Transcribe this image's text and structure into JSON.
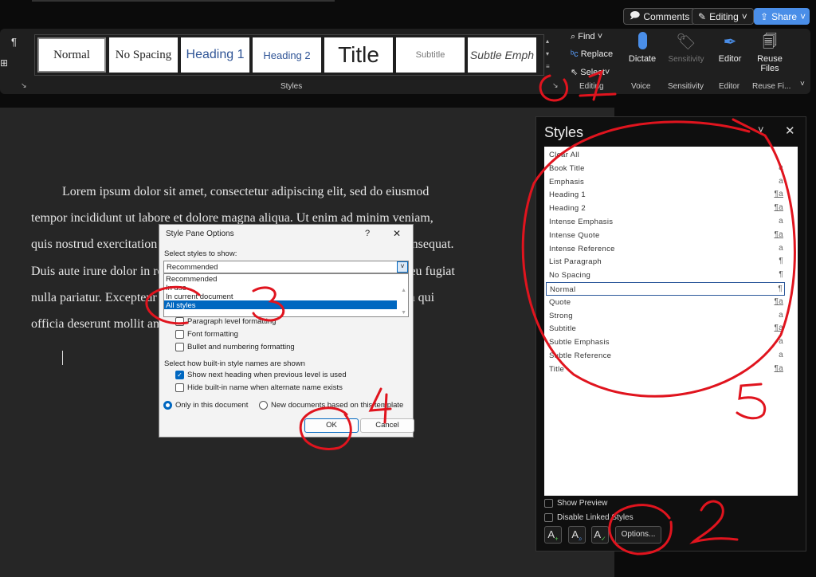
{
  "topbar": {
    "comments": "Comments",
    "editing": "Editing",
    "share": "Share"
  },
  "ribbon": {
    "gallery": [
      "Normal",
      "No Spacing",
      "Heading 1",
      "Heading 2",
      "Title",
      "Subtitle",
      "Subtle Emph"
    ],
    "styles_group": "Styles",
    "editing": {
      "find": "Find",
      "replace": "Replace",
      "select": "Select",
      "group": "Editing"
    },
    "voice": {
      "dictate": "Dictate",
      "group": "Voice"
    },
    "sensitivity": {
      "label": "Sensitivity",
      "group": "Sensitivity"
    },
    "editor": {
      "label": "Editor",
      "group": "Editor"
    },
    "reuse": {
      "label1": "Reuse",
      "label2": "Files",
      "group": "Reuse Fi..."
    },
    "pilcrow": "¶"
  },
  "document": {
    "lines": [
      "Lorem ipsum dolor sit amet, consectetur adipiscing elit, sed do eiusmod",
      "tempor incididunt ut labore et dolore magna aliqua. Ut enim ad minim veniam,",
      "quis nostrud exercitation ullamco laboris nisi ut aliquip ex ea commodo consequat.",
      "Duis aute irure dolor in reprehenderit in voluptate velit esse cillum dolore eu fugiat",
      "nulla pariatur. Excepteur sint occaecat cupidatat non proident, sunt in culpa qui",
      "officia deserunt mollit anim id est laborum."
    ]
  },
  "styles_pane": {
    "title": "Styles",
    "items": [
      {
        "name": "Clear All",
        "mark": ""
      },
      {
        "name": "Book Title",
        "mark": "a"
      },
      {
        "name": "Emphasis",
        "mark": "a"
      },
      {
        "name": "Heading 1",
        "mark": "¶a"
      },
      {
        "name": "Heading 2",
        "mark": "¶a"
      },
      {
        "name": "Intense Emphasis",
        "mark": "a"
      },
      {
        "name": "Intense Quote",
        "mark": "¶a"
      },
      {
        "name": "Intense Reference",
        "mark": "a"
      },
      {
        "name": "List Paragraph",
        "mark": "¶"
      },
      {
        "name": "No Spacing",
        "mark": "¶"
      },
      {
        "name": "Normal",
        "mark": "¶"
      },
      {
        "name": "Quote",
        "mark": "¶a"
      },
      {
        "name": "Strong",
        "mark": "a"
      },
      {
        "name": "Subtitle",
        "mark": "¶a"
      },
      {
        "name": "Subtle Emphasis",
        "mark": "a"
      },
      {
        "name": "Subtle Reference",
        "mark": "a"
      },
      {
        "name": "Title",
        "mark": "¶a"
      }
    ],
    "selected": "Normal",
    "show_preview": "Show Preview",
    "disable_linked": "Disable Linked Styles",
    "options": "Options..."
  },
  "dialog": {
    "title": "Style Pane Options",
    "help": "?",
    "select_label": "Select styles to show:",
    "select_value": "Recommended",
    "options": [
      "Recommended",
      "In use",
      "In current document",
      "All styles"
    ],
    "highlighted": "All styles",
    "chk_paragraph": "Paragraph level formatting",
    "chk_font": "Font formatting",
    "chk_bullet": "Bullet and numbering formatting",
    "names_label": "Select how built-in style names are shown",
    "chk_show_next": "Show next heading when previous level is used",
    "chk_hide_builtin": "Hide built-in name when alternate name exists",
    "radio_only": "Only in this document",
    "radio_new": "New documents based on this template",
    "ok": "OK",
    "cancel": "Cancel"
  },
  "annotations_color": "#e0141e"
}
